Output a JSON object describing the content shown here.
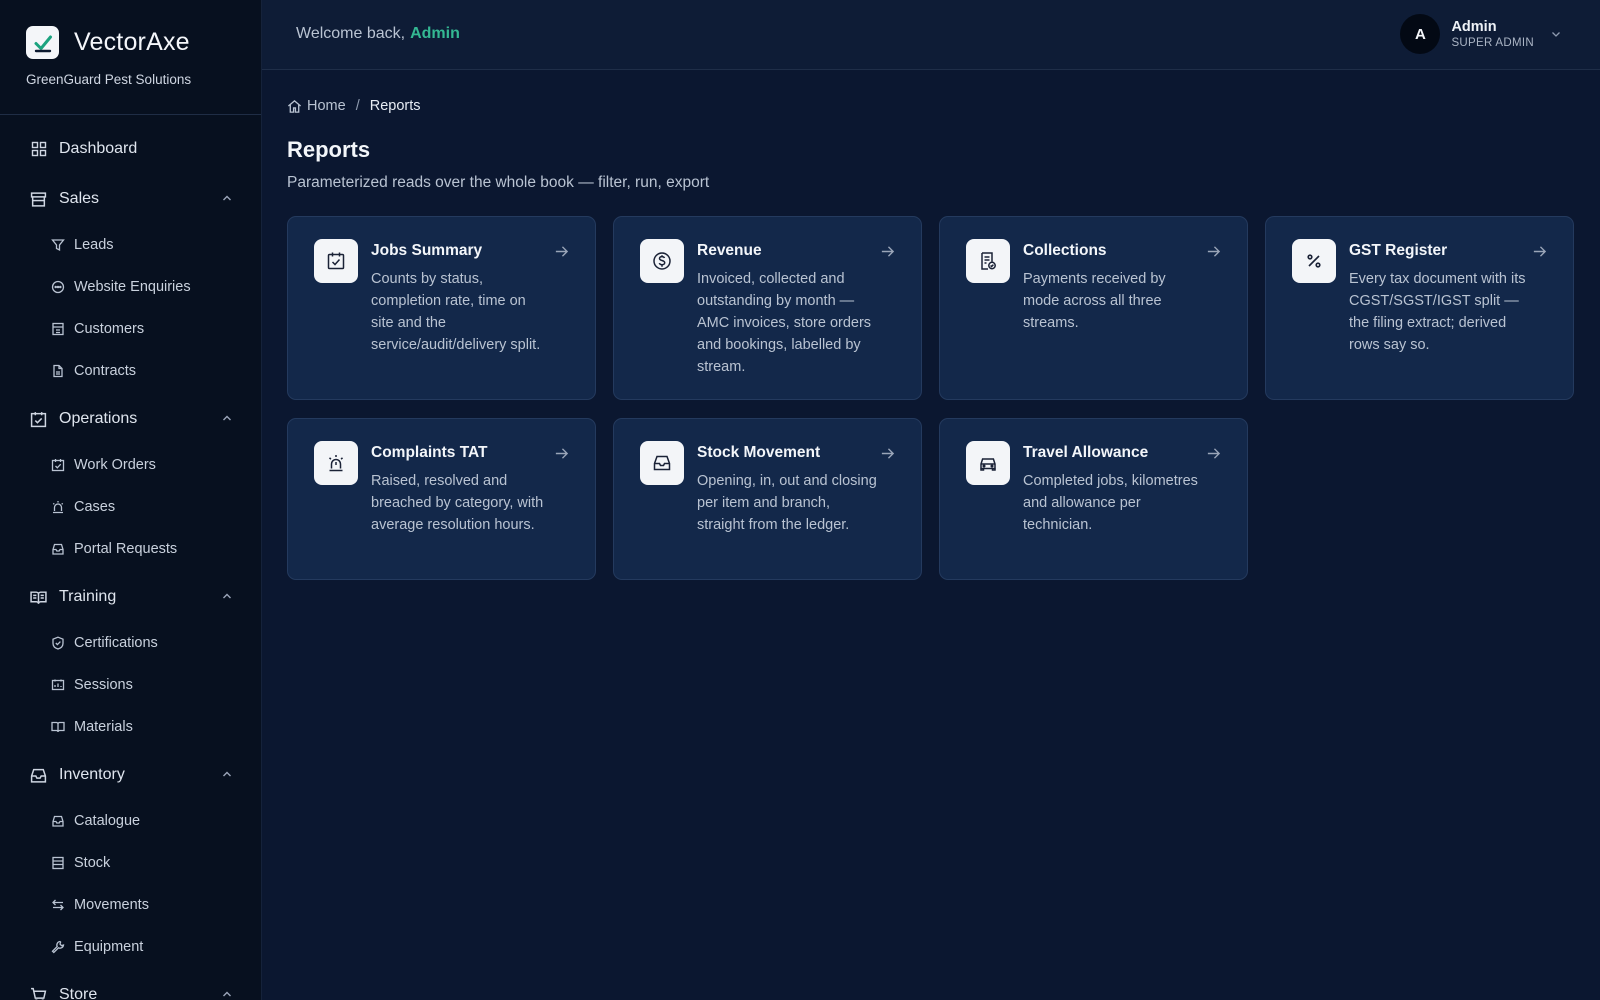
{
  "brand": {
    "name": "VectorAxe",
    "company": "GreenGuard Pest Solutions",
    "accent": "#34b893"
  },
  "topbar": {
    "welcome_prefix": "Welcome back,",
    "welcome_name": "Admin",
    "user": {
      "initial": "A",
      "name": "Admin",
      "role": "SUPER ADMIN"
    }
  },
  "sidebar": {
    "dashboard": {
      "label": "Dashboard",
      "icon": "grid-icon"
    },
    "sales": {
      "label": "Sales",
      "icon": "store-icon",
      "items": [
        {
          "label": "Leads",
          "icon": "funnel-icon"
        },
        {
          "label": "Website Enquiries",
          "icon": "chat-icon"
        },
        {
          "label": "Customers",
          "icon": "building-icon"
        },
        {
          "label": "Contracts",
          "icon": "document-icon"
        }
      ]
    },
    "operations": {
      "label": "Operations",
      "icon": "calendar-check-icon",
      "items": [
        {
          "label": "Work Orders",
          "icon": "calendar-check-icon"
        },
        {
          "label": "Cases",
          "icon": "siren-icon"
        },
        {
          "label": "Portal Requests",
          "icon": "inbox-icon"
        }
      ]
    },
    "training": {
      "label": "Training",
      "icon": "book-icon",
      "items": [
        {
          "label": "Certifications",
          "icon": "shield-check-icon"
        },
        {
          "label": "Sessions",
          "icon": "presentation-icon"
        },
        {
          "label": "Materials",
          "icon": "book-icon"
        }
      ]
    },
    "inventory": {
      "label": "Inventory",
      "icon": "inbox-icon",
      "items": [
        {
          "label": "Catalogue",
          "icon": "inbox-icon"
        },
        {
          "label": "Stock",
          "icon": "list-icon"
        },
        {
          "label": "Movements",
          "icon": "swap-icon"
        },
        {
          "label": "Equipment",
          "icon": "wrench-icon"
        }
      ]
    },
    "store": {
      "label": "Store",
      "icon": "cart-icon"
    }
  },
  "breadcrumb": {
    "home": "Home",
    "separator": "/",
    "current": "Reports"
  },
  "page": {
    "title": "Reports",
    "subtitle": "Parameterized reads over the whole book — filter, run, export"
  },
  "reports": [
    {
      "title": "Jobs Summary",
      "icon": "calendar-check-icon",
      "desc": "Counts by status, completion rate, time on site and the service/audit/delivery split."
    },
    {
      "title": "Revenue",
      "icon": "dollar-circle-icon",
      "desc": "Invoiced, collected and outstanding by month — AMC invoices, store orders and bookings, labelled by stream."
    },
    {
      "title": "Collections",
      "icon": "receipt-check-icon",
      "desc": "Payments received by mode across all three streams."
    },
    {
      "title": "GST Register",
      "icon": "percent-icon",
      "desc": "Every tax document with its CGST/SGST/IGST split — the filing extract; derived rows say so."
    },
    {
      "title": "Complaints TAT",
      "icon": "siren-icon",
      "desc": "Raised, resolved and breached by category, with average resolution hours."
    },
    {
      "title": "Stock Movement",
      "icon": "inbox-icon",
      "desc": "Opening, in, out and closing per item and branch, straight from the ledger."
    },
    {
      "title": "Travel Allowance",
      "icon": "car-icon",
      "desc": "Completed jobs, kilometres and allowance per technician."
    }
  ]
}
